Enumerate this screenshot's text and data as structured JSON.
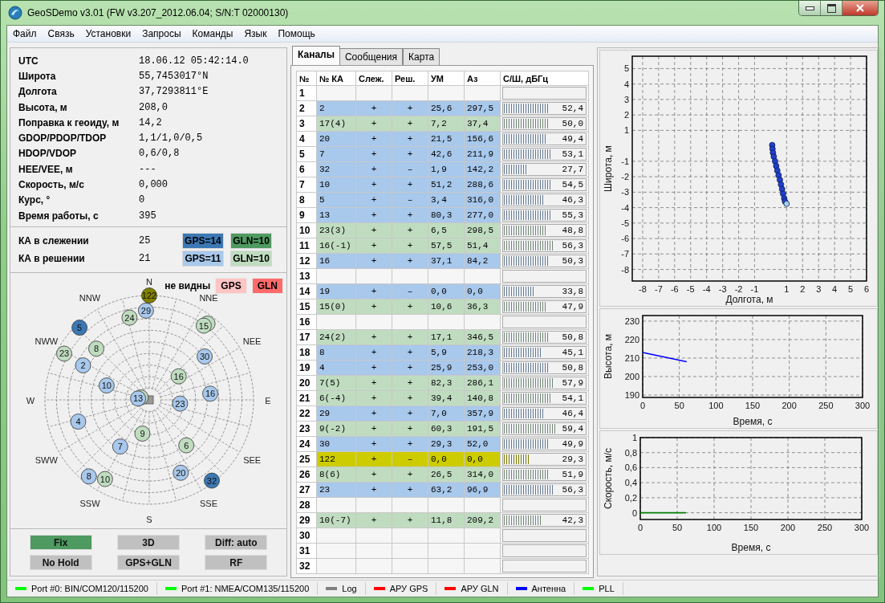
{
  "window": {
    "title": "GeoSDemo v3.01 (FW v3.207_2012.06.04; S/N:T 02000130)"
  },
  "menu": [
    "Файл",
    "Связь",
    "Установки",
    "Запросы",
    "Команды",
    "Язык",
    "Помощь"
  ],
  "info": [
    {
      "label": "UTC",
      "value": "18.06.12 05:42:14.0"
    },
    {
      "label": "Широта",
      "value": "55,7453017°N"
    },
    {
      "label": "Долгота",
      "value": "37,7293811°E"
    },
    {
      "label": "Высота, м",
      "value": "208,0"
    },
    {
      "label": "Поправка к геоиду, м",
      "value": "14,2"
    },
    {
      "label": "GDOP/PDOP/TDOP",
      "value": "1,1/1,0/0,5"
    },
    {
      "label": "HDOP/VDOP",
      "value": "0,6/0,8"
    },
    {
      "label": "HEE/VEE, м",
      "value": "---"
    },
    {
      "label": "Скорость, м/с",
      "value": "0,000"
    },
    {
      "label": "Курс, °",
      "value": "0"
    },
    {
      "label": "Время работы, с",
      "value": "395"
    }
  ],
  "counts": [
    {
      "label": "КА в слежении",
      "value": "25",
      "badges": [
        {
          "text": "GPS=14",
          "color": "#3c78b4"
        },
        {
          "text": "GLN=10",
          "color": "#4e9a60"
        }
      ]
    },
    {
      "label": "КА в решении",
      "value": "21",
      "badges": [
        {
          "text": "GPS=11",
          "color": "#a8c8ec"
        },
        {
          "text": "GLN=10",
          "color": "#c0dcc0"
        }
      ]
    }
  ],
  "sky": {
    "hidden_label": "не видны",
    "hidden_badges": [
      {
        "text": "GPS",
        "color": "#ffc4c4"
      },
      {
        "text": "GLN",
        "color": "#ff6b6b"
      }
    ],
    "compass": [
      "N",
      "NNE",
      "NEE",
      "E",
      "SEE",
      "SSE",
      "S",
      "SSW",
      "SWW",
      "W",
      "NWW",
      "NNW"
    ],
    "satellites": [
      {
        "color": "#c0dcc0"
      },
      {
        "color": "#c0dcc0"
      },
      {
        "label": "2",
        "color": "#a8c8ec"
      },
      {
        "label": "20",
        "color": "#a8c8ec"
      },
      {
        "label": "7",
        "color": "#a8c8ec"
      },
      {
        "label": "32",
        "color": "#3c78b4"
      },
      {
        "label": "10",
        "color": "#a8c8ec"
      },
      {
        "label": "5",
        "color": "#3c78b4"
      },
      {
        "label": "13",
        "color": "#a8c8ec"
      },
      {
        "label": "23",
        "color": "#c0dcc0"
      },
      {
        "label": "16",
        "color": "#c0dcc0"
      },
      {
        "label": "16",
        "color": "#a8c8ec"
      },
      {
        "label": "15",
        "color": "#c0dcc0"
      },
      {
        "label": "24",
        "color": "#c0dcc0"
      },
      {
        "label": "8",
        "color": "#a8c8ec"
      },
      {
        "label": "4",
        "color": "#a8c8ec"
      },
      {
        "label": "6",
        "color": "#c0dcc0"
      },
      {
        "label": "29",
        "color": "#a8c8ec"
      },
      {
        "label": "9",
        "color": "#c0dcc0"
      },
      {
        "label": "30",
        "color": "#a8c8ec"
      },
      {
        "label": "8",
        "color": "#c0dcc0"
      },
      {
        "label": "23",
        "color": "#a8c8ec"
      },
      {
        "label": "10",
        "color": "#c0dcc0"
      },
      {
        "label": "122",
        "color": "#808000"
      }
    ]
  },
  "buttons": [
    {
      "label": "Fix",
      "on": true
    },
    {
      "label": "3D",
      "on": false
    },
    {
      "label": "Diff: auto",
      "on": false
    },
    {
      "label": "No Hold",
      "on": false
    },
    {
      "label": "GPS+GLN",
      "on": false
    },
    {
      "label": "RF",
      "on": false
    }
  ],
  "tabs": [
    {
      "label": "Каналы",
      "selected": true
    },
    {
      "label": "Сообщения",
      "selected": false
    },
    {
      "label": "Карта",
      "selected": false
    }
  ],
  "table": {
    "columns": [
      "№",
      "№ КА",
      "Слеж.",
      "Реш.",
      "УМ",
      "Аз",
      "С/Ш, дБГц"
    ],
    "rows": [
      {
        "no": "1"
      },
      {
        "no": "2",
        "sat": "2",
        "color": "#a8c8ec",
        "tracking": "+",
        "solution": "+",
        "elevation": "25,6",
        "azimuth": "297,5",
        "snr": "52,4",
        "level": 0.55
      },
      {
        "no": "3",
        "sat": "17(4)",
        "color": "#c0dcc0",
        "tracking": "+",
        "solution": "+",
        "elevation": "7,2",
        "azimuth": "37,4",
        "snr": "50,0",
        "level": 0.53
      },
      {
        "no": "4",
        "sat": "20",
        "color": "#a8c8ec",
        "tracking": "+",
        "solution": "+",
        "elevation": "21,5",
        "azimuth": "156,6",
        "snr": "49,4",
        "level": 0.52
      },
      {
        "no": "5",
        "sat": "7",
        "color": "#a8c8ec",
        "tracking": "+",
        "solution": "+",
        "elevation": "42,6",
        "azimuth": "211,9",
        "snr": "53,1",
        "level": 0.56
      },
      {
        "no": "6",
        "sat": "32",
        "color": "#a8c8ec",
        "tracking": "+",
        "solution": "–",
        "elevation": "1,9",
        "azimuth": "142,2",
        "snr": "27,7",
        "level": 0.29
      },
      {
        "no": "7",
        "sat": "10",
        "color": "#a8c8ec",
        "tracking": "+",
        "solution": "+",
        "elevation": "51,2",
        "azimuth": "288,6",
        "snr": "54,5",
        "level": 0.57
      },
      {
        "no": "8",
        "sat": "5",
        "color": "#a8c8ec",
        "tracking": "+",
        "solution": "–",
        "elevation": "3,4",
        "azimuth": "316,0",
        "snr": "46,3",
        "level": 0.49
      },
      {
        "no": "9",
        "sat": "13",
        "color": "#a8c8ec",
        "tracking": "+",
        "solution": "+",
        "elevation": "80,3",
        "azimuth": "277,0",
        "snr": "55,3",
        "level": 0.58
      },
      {
        "no": "10",
        "sat": "23(3)",
        "color": "#c0dcc0",
        "tracking": "+",
        "solution": "+",
        "elevation": "6,5",
        "azimuth": "298,5",
        "snr": "48,8",
        "level": 0.51
      },
      {
        "no": "11",
        "sat": "16(-1)",
        "color": "#c0dcc0",
        "tracking": "+",
        "solution": "+",
        "elevation": "57,5",
        "azimuth": "51,4",
        "snr": "56,3",
        "level": 0.59
      },
      {
        "no": "12",
        "sat": "16",
        "color": "#a8c8ec",
        "tracking": "+",
        "solution": "+",
        "elevation": "37,1",
        "azimuth": "84,2",
        "snr": "50,3",
        "level": 0.53
      },
      {
        "no": "13"
      },
      {
        "no": "14",
        "sat": "19",
        "color": "#a8c8ec",
        "tracking": "+",
        "solution": "–",
        "elevation": "0,0",
        "azimuth": "0,0",
        "snr": "33,8",
        "level": 0.36
      },
      {
        "no": "15",
        "sat": "15(0)",
        "color": "#c0dcc0",
        "tracking": "+",
        "solution": "+",
        "elevation": "10,6",
        "azimuth": "36,3",
        "snr": "47,9",
        "level": 0.5
      },
      {
        "no": "16"
      },
      {
        "no": "17",
        "sat": "24(2)",
        "color": "#c0dcc0",
        "tracking": "+",
        "solution": "+",
        "elevation": "17,1",
        "azimuth": "346,5",
        "snr": "50,8",
        "level": 0.53
      },
      {
        "no": "18",
        "sat": "8",
        "color": "#a8c8ec",
        "tracking": "+",
        "solution": "+",
        "elevation": "5,9",
        "azimuth": "218,3",
        "snr": "45,1",
        "level": 0.47
      },
      {
        "no": "19",
        "sat": "4",
        "color": "#a8c8ec",
        "tracking": "+",
        "solution": "+",
        "elevation": "25,9",
        "azimuth": "253,0",
        "snr": "50,8",
        "level": 0.53
      },
      {
        "no": "20",
        "sat": "7(5)",
        "color": "#c0dcc0",
        "tracking": "+",
        "solution": "+",
        "elevation": "82,3",
        "azimuth": "286,1",
        "snr": "57,9",
        "level": 0.61
      },
      {
        "no": "21",
        "sat": "6(-4)",
        "color": "#c0dcc0",
        "tracking": "+",
        "solution": "+",
        "elevation": "39,4",
        "azimuth": "140,8",
        "snr": "54,1",
        "level": 0.57
      },
      {
        "no": "22",
        "sat": "29",
        "color": "#a8c8ec",
        "tracking": "+",
        "solution": "+",
        "elevation": "7,0",
        "azimuth": "357,9",
        "snr": "46,4",
        "level": 0.49
      },
      {
        "no": "23",
        "sat": "9(-2)",
        "color": "#c0dcc0",
        "tracking": "+",
        "solution": "+",
        "elevation": "60,3",
        "azimuth": "191,5",
        "snr": "59,4",
        "level": 0.63
      },
      {
        "no": "24",
        "sat": "30",
        "color": "#a8c8ec",
        "tracking": "+",
        "solution": "+",
        "elevation": "29,3",
        "azimuth": "52,0",
        "snr": "49,9",
        "level": 0.53
      },
      {
        "no": "25",
        "sat": "122",
        "color": "#cccc00",
        "tracking": "+",
        "solution": "–",
        "elevation": "0,0",
        "azimuth": "0,0",
        "snr": "29,3",
        "level": 0.31
      },
      {
        "no": "26",
        "sat": "8(6)",
        "color": "#c0dcc0",
        "tracking": "+",
        "solution": "+",
        "elevation": "26,5",
        "azimuth": "314,0",
        "snr": "51,9",
        "level": 0.55
      },
      {
        "no": "27",
        "sat": "23",
        "color": "#a8c8ec",
        "tracking": "+",
        "solution": "+",
        "elevation": "63,2",
        "azimuth": "96,9",
        "snr": "56,3",
        "level": 0.59
      },
      {
        "no": "28"
      },
      {
        "no": "29",
        "sat": "10(-7)",
        "color": "#c0dcc0",
        "tracking": "+",
        "solution": "+",
        "elevation": "11,8",
        "azimuth": "209,2",
        "snr": "42,3",
        "level": 0.45
      },
      {
        "no": "30"
      },
      {
        "no": "31"
      },
      {
        "no": "32"
      }
    ]
  },
  "plots": [
    {
      "chart_data": {
        "type": "scatter",
        "xlabel": "Долгота, м",
        "ylabel": "Широта, м",
        "grid": true,
        "xlim": [
          -8.65,
          6
        ],
        "ylim": [
          -8.75,
          5.8
        ],
        "xticks": [
          -8,
          -7,
          -6,
          -5,
          -4,
          -3,
          -2,
          -1,
          1,
          2,
          3,
          4,
          5,
          6
        ],
        "yticks": [
          -8,
          -7,
          -6,
          -5,
          -4,
          -3,
          -2,
          -1,
          1,
          2,
          3,
          4,
          5
        ],
        "series": [
          {
            "color": "#1f3fd0",
            "x": [
              0.1,
              0.12,
              0.15,
              0.2,
              0.28,
              0.35,
              0.42,
              0.5,
              0.58,
              0.65,
              0.72,
              0.78,
              0.85,
              0.9
            ],
            "values": [
              0.05,
              -0.2,
              -0.45,
              -0.7,
              -1.0,
              -1.3,
              -1.6,
              -1.9,
              -2.2,
              -2.5,
              -2.8,
              -3.1,
              -3.4,
              -3.6
            ]
          },
          {
            "color": "#a0d0f0",
            "x": [
              1.0
            ],
            "values": [
              -3.75
            ]
          }
        ]
      }
    },
    {
      "chart_data": {
        "type": "line",
        "xlabel": "Время, с",
        "ylabel": "Высота, м",
        "grid": true,
        "xlim": [
          0,
          300
        ],
        "ylim": [
          188.7,
          233
        ],
        "xticks": [
          0,
          50,
          100,
          150,
          200,
          250,
          300
        ],
        "yticks": [
          190,
          200,
          210,
          220,
          230
        ],
        "x": [
          0,
          60
        ],
        "series": [
          {
            "color": "#0000ff",
            "values": [
              213,
              208
            ]
          }
        ]
      }
    },
    {
      "chart_data": {
        "type": "line",
        "xlabel": "Время, с",
        "ylabel": "Скорость, м/с",
        "grid": true,
        "xlim": [
          0,
          300
        ],
        "ylim": [
          -0.09,
          1
        ],
        "xticks": [
          0,
          50,
          100,
          150,
          200,
          250,
          300
        ],
        "yticks": [
          0,
          {
            "value": 0.2,
            "label": "0,2"
          },
          {
            "value": 0.4,
            "label": "0,4"
          },
          {
            "value": 0.6,
            "label": "0,6"
          },
          {
            "value": 0.8,
            "label": "0,8"
          },
          1
        ],
        "x": [
          0,
          62
        ],
        "series": [
          {
            "color": "#008000",
            "values": [
              0,
              0
            ]
          }
        ]
      }
    }
  ],
  "status_bar": [
    {
      "label": "Port #0: BIN/COM120/115200",
      "color": "#00ff00"
    },
    {
      "label": "Port #1: NMEA/COM135/115200",
      "color": "#00ff00"
    },
    {
      "label": "Log",
      "color": "#808080"
    },
    {
      "label": "АРУ GPS",
      "color": "#ff0000"
    },
    {
      "label": "АРУ GLN",
      "color": "#ff0000"
    },
    {
      "label": "Антенна",
      "color": "#0000ff"
    },
    {
      "label": "PLL",
      "color": "#00ff00"
    }
  ]
}
